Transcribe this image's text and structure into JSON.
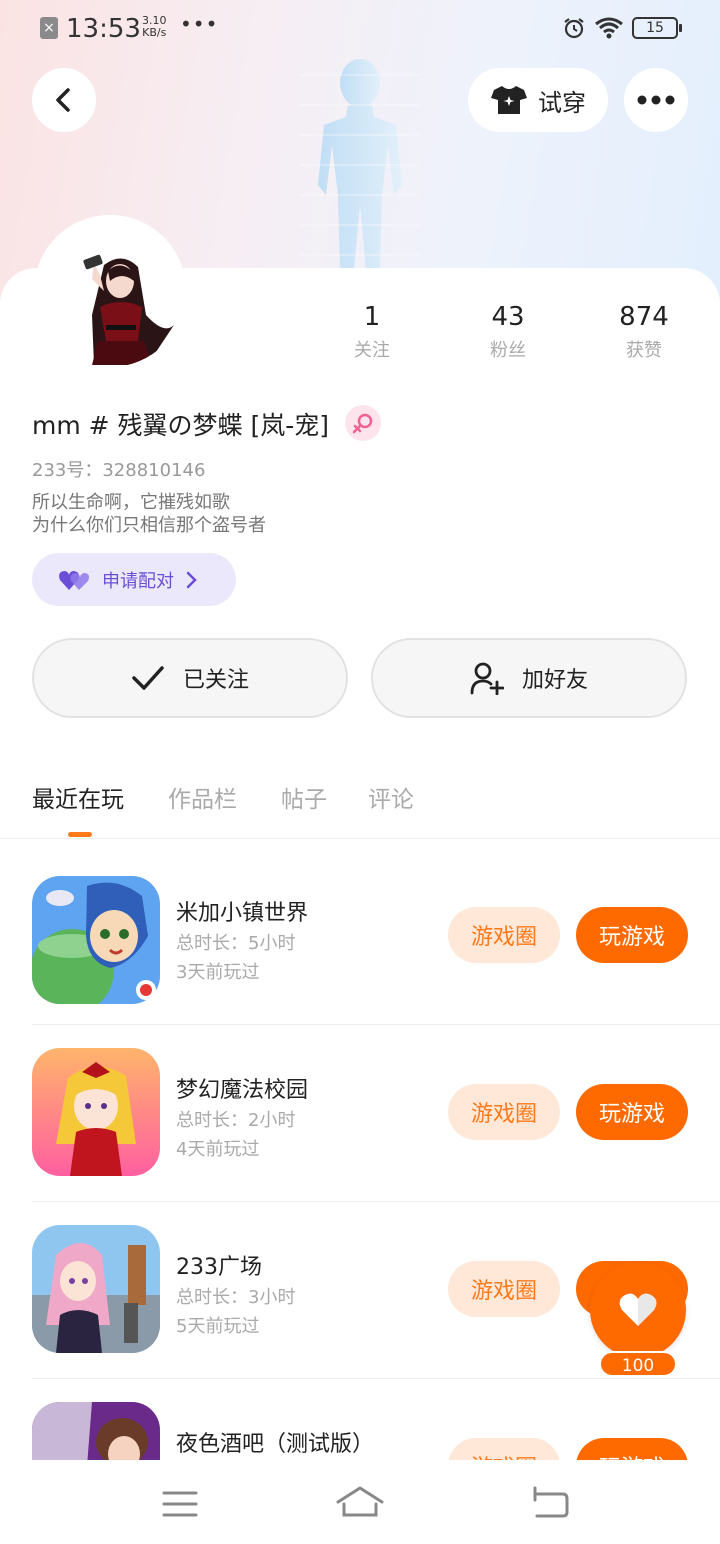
{
  "status_bar": {
    "notify_icon": "close-notification-icon",
    "time": "13:53",
    "speed_value": "3.10",
    "speed_unit": "KB/s",
    "more": "•••",
    "battery": "15"
  },
  "header": {
    "back_icon": "chevron-left-icon",
    "tryon_label": "试穿",
    "tryon_icon": "tshirt-icon",
    "more_icon": "more-horizontal-icon"
  },
  "profile": {
    "nickname": "mm # 残翼の梦蝶 [岚-宠]",
    "gender_icon": "female-icon",
    "uid": "233号：328810146",
    "bio_lines": [
      "所以生命啊，它摧残如歌",
      "为什么你们只相信那个盗号者"
    ],
    "stats": [
      {
        "value": "1",
        "label": "关注"
      },
      {
        "value": "43",
        "label": "粉丝"
      },
      {
        "value": "874",
        "label": "获赞"
      }
    ],
    "pair_label": "申请配对"
  },
  "actions": {
    "follow_label": "已关注",
    "add_friend_label": "加好友"
  },
  "tabs": [
    {
      "label": "最近在玩",
      "active": true
    },
    {
      "label": "作品栏",
      "active": false
    },
    {
      "label": "帖子",
      "active": false
    },
    {
      "label": "评论",
      "active": false
    }
  ],
  "games": [
    {
      "name": "米加小镇世界",
      "duration": "总时长：5小时",
      "last_played": "3天前玩过",
      "circle_label": "游戏圈",
      "play_label": "玩游戏"
    },
    {
      "name": "梦幻魔法校园",
      "duration": "总时长：2小时",
      "last_played": "4天前玩过",
      "circle_label": "游戏圈",
      "play_label": "玩游戏"
    },
    {
      "name": "233广场",
      "duration": "总时长：3小时",
      "last_played": "5天前玩过",
      "circle_label": "游戏圈",
      "play_label": "玩游戏"
    },
    {
      "name": "夜色酒吧（测试版）",
      "duration": "",
      "last_played": "",
      "circle_label": "游戏圈",
      "play_label": "玩游戏"
    }
  ],
  "like_fab": {
    "count": "100",
    "icon": "heart-icon"
  },
  "colors": {
    "accent": "#ff6a00",
    "accent_light": "#ffe8d8",
    "pair_purple": "#6a4fd6"
  }
}
